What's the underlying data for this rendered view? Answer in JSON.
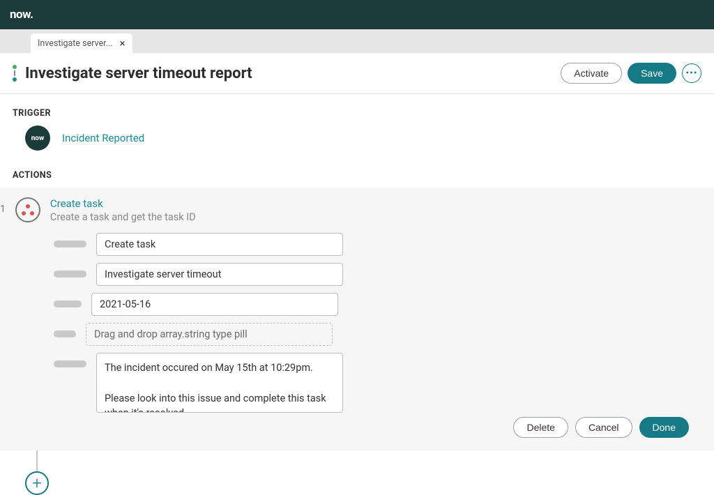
{
  "brand": "now.",
  "tab": {
    "label": "Investigate server..."
  },
  "header": {
    "title": "Investigate server timeout report",
    "activate": "Activate",
    "save": "Save"
  },
  "sections": {
    "trigger": "TRIGGER",
    "actions": "ACTIONS"
  },
  "trigger": {
    "icon_text": "now",
    "name": "Incident Reported"
  },
  "action": {
    "num": "1",
    "title": "Create task",
    "subtitle": "Create a task and get the task ID",
    "fields": {
      "f1": "Create task",
      "f2": "Investigate server timeout",
      "f3": "2021-05-16",
      "f4_placeholder": "Drag and drop array.string type pill",
      "f5": "The incident occured on May 15th at 10:29pm.\n\nPlease look into this issue and complete this task when it's resolved."
    },
    "buttons": {
      "delete": "Delete",
      "cancel": "Cancel",
      "done": "Done"
    }
  }
}
